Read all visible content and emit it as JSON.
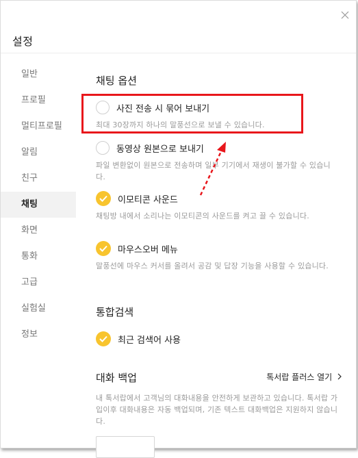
{
  "window": {
    "title": "설정"
  },
  "sidebar": {
    "items": [
      {
        "label": "일반"
      },
      {
        "label": "프로필"
      },
      {
        "label": "멀티프로필"
      },
      {
        "label": "알림"
      },
      {
        "label": "친구"
      },
      {
        "label": "채팅",
        "active": true
      },
      {
        "label": "화면"
      },
      {
        "label": "통화"
      },
      {
        "label": "고급"
      },
      {
        "label": "실험실"
      },
      {
        "label": "정보"
      }
    ]
  },
  "chat_options": {
    "heading": "채팅 옵션",
    "bundle_photos": {
      "label": "사진 전송 시 묶어 보내기",
      "desc": "최대 30장까지 하나의 말풍선으로 보낼 수 있습니다.",
      "checked": false
    },
    "original_video": {
      "label": "동영상 원본으로 보내기",
      "desc": "파일 변환없이 원본으로 전송하며 일부 기기에서 재생이 불가할 수 있습니다.",
      "checked": false
    },
    "emoticon_sound": {
      "label": "이모티콘 사운드",
      "desc": "채팅방 내에서 소리나는 이모티콘의 사운드를 켜고 끌 수 있습니다.",
      "checked": true
    },
    "mouseover_menu": {
      "label": "마우스오버 메뉴",
      "desc": "말풍선에 마우스 커서를 올려서 공감 및 답장 기능을 사용할 수 있습니다.",
      "checked": true
    }
  },
  "integrated_search": {
    "heading": "통합검색",
    "recent_search": {
      "label": "최근 검색어 사용",
      "checked": true
    }
  },
  "chat_backup": {
    "heading": "대화 백업",
    "link": "톡서랍 플러스 열기",
    "desc": "내 톡서랍에서 고객님의 대화내용을 안전하게 보관하고 있습니다. 톡서랍 가입이후 대화내용은 자동 백업되며, 기존 텍스트 대화백업은 지원하지 않습니다."
  },
  "colors": {
    "accent": "#f8c42e",
    "highlight": "#e8161b",
    "active_bg": "#f2f2f2"
  },
  "icons": [
    "close-icon",
    "radio-unchecked-icon",
    "check-circle-icon",
    "chevron-right-icon",
    "arrow-annotation-icon"
  ]
}
